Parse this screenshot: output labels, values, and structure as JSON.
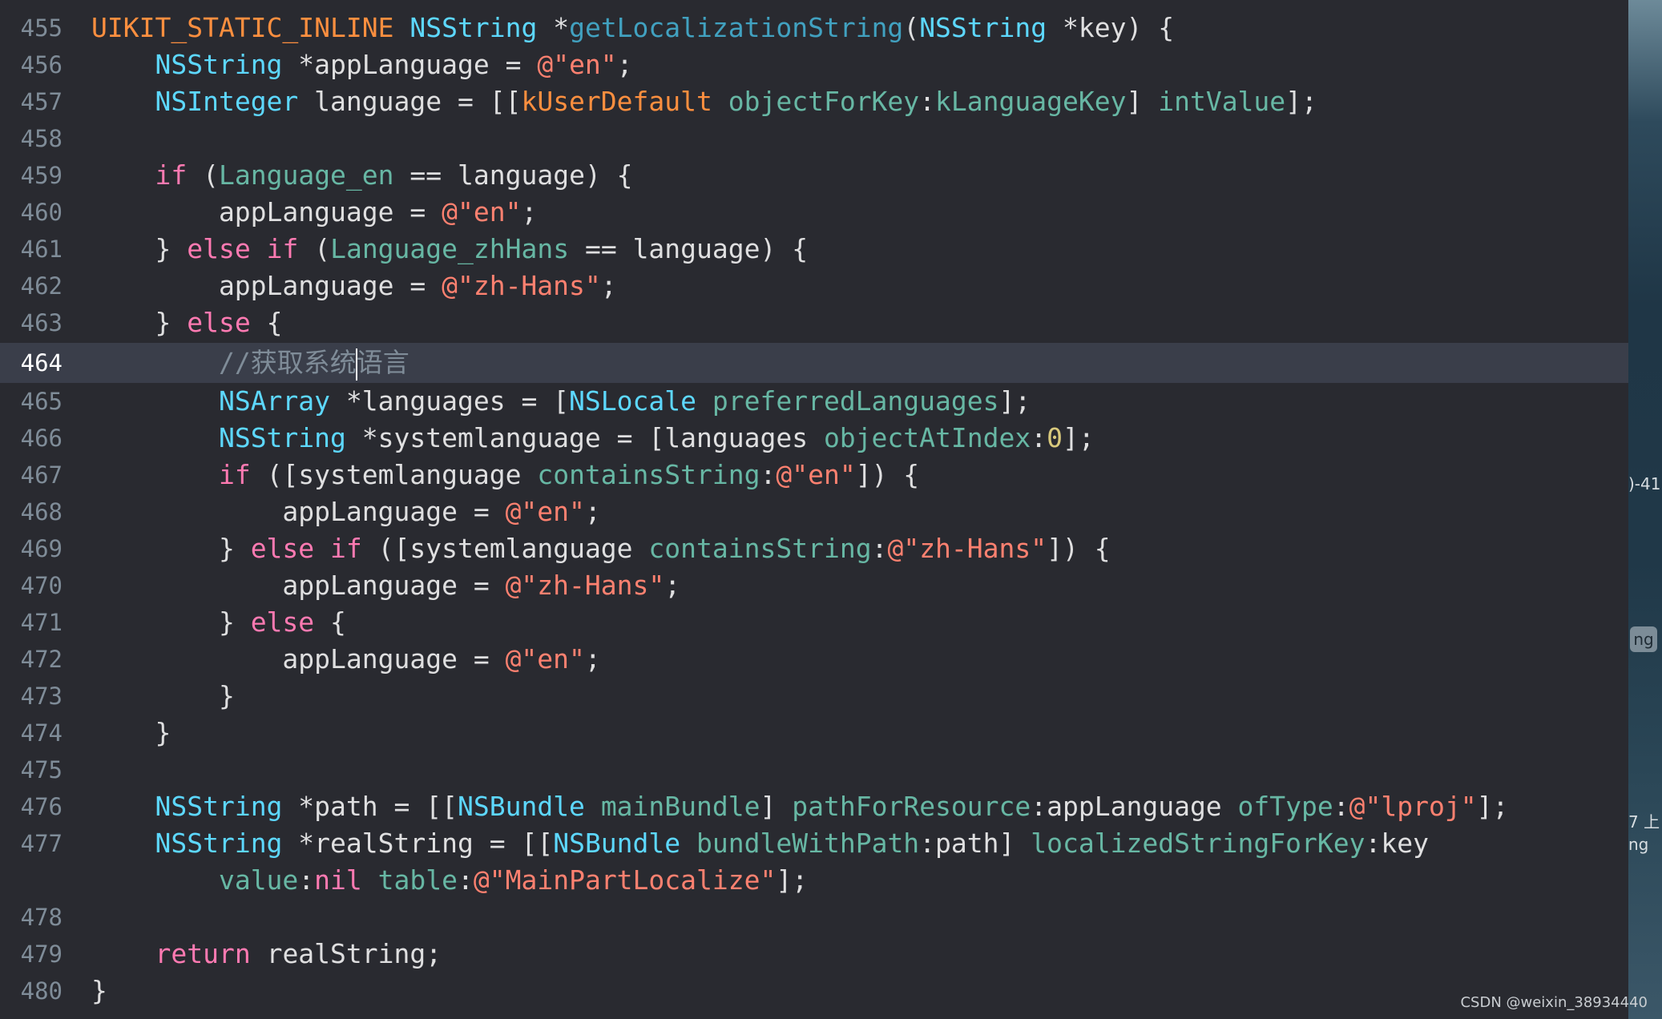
{
  "lines": [
    {
      "num": "455",
      "tokens": [
        {
          "t": "UIKIT_STATIC_INLINE",
          "c": "macro"
        },
        {
          "t": " ",
          "c": "plain"
        },
        {
          "t": "NSString",
          "c": "type"
        },
        {
          "t": " *",
          "c": "plain"
        },
        {
          "t": "getLocalizationString",
          "c": "decl"
        },
        {
          "t": "(",
          "c": "plain"
        },
        {
          "t": "NSString",
          "c": "type"
        },
        {
          "t": " *key) {",
          "c": "plain"
        }
      ]
    },
    {
      "num": "456",
      "tokens": [
        {
          "t": "    ",
          "c": "plain"
        },
        {
          "t": "NSString",
          "c": "type"
        },
        {
          "t": " *appLanguage = ",
          "c": "plain"
        },
        {
          "t": "@\"en\"",
          "c": "str"
        },
        {
          "t": ";",
          "c": "plain"
        }
      ]
    },
    {
      "num": "457",
      "tokens": [
        {
          "t": "    ",
          "c": "plain"
        },
        {
          "t": "NSInteger",
          "c": "type"
        },
        {
          "t": " language = [[",
          "c": "plain"
        },
        {
          "t": "kUserDefault",
          "c": "kuser"
        },
        {
          "t": " ",
          "c": "plain"
        },
        {
          "t": "objectForKey",
          "c": "fn"
        },
        {
          "t": ":",
          "c": "plain"
        },
        {
          "t": "kLanguageKey",
          "c": "fn"
        },
        {
          "t": "] ",
          "c": "plain"
        },
        {
          "t": "intValue",
          "c": "fn"
        },
        {
          "t": "];",
          "c": "plain"
        }
      ]
    },
    {
      "num": "458",
      "tokens": []
    },
    {
      "num": "459",
      "tokens": [
        {
          "t": "    ",
          "c": "plain"
        },
        {
          "t": "if",
          "c": "kw"
        },
        {
          "t": " (",
          "c": "plain"
        },
        {
          "t": "Language_en",
          "c": "fn"
        },
        {
          "t": " == language) {",
          "c": "plain"
        }
      ]
    },
    {
      "num": "460",
      "tokens": [
        {
          "t": "        appLanguage = ",
          "c": "plain"
        },
        {
          "t": "@\"en\"",
          "c": "str"
        },
        {
          "t": ";",
          "c": "plain"
        }
      ]
    },
    {
      "num": "461",
      "tokens": [
        {
          "t": "    } ",
          "c": "plain"
        },
        {
          "t": "else",
          "c": "kw"
        },
        {
          "t": " ",
          "c": "plain"
        },
        {
          "t": "if",
          "c": "kw"
        },
        {
          "t": " (",
          "c": "plain"
        },
        {
          "t": "Language_zhHans",
          "c": "fn"
        },
        {
          "t": " == language) {",
          "c": "plain"
        }
      ]
    },
    {
      "num": "462",
      "tokens": [
        {
          "t": "        appLanguage = ",
          "c": "plain"
        },
        {
          "t": "@\"zh-Hans\"",
          "c": "str"
        },
        {
          "t": ";",
          "c": "plain"
        }
      ]
    },
    {
      "num": "463",
      "tokens": [
        {
          "t": "    } ",
          "c": "plain"
        },
        {
          "t": "else",
          "c": "kw"
        },
        {
          "t": " {",
          "c": "plain"
        }
      ]
    },
    {
      "num": "464",
      "current": true,
      "tokens": [
        {
          "t": "        ",
          "c": "plain"
        },
        {
          "t": "//获取系统",
          "c": "comment"
        },
        {
          "t": "",
          "c": "cursor"
        },
        {
          "t": "语言",
          "c": "comment"
        }
      ]
    },
    {
      "num": "465",
      "tokens": [
        {
          "t": "        ",
          "c": "plain"
        },
        {
          "t": "NSArray",
          "c": "type"
        },
        {
          "t": " *languages = [",
          "c": "plain"
        },
        {
          "t": "NSLocale",
          "c": "type"
        },
        {
          "t": " ",
          "c": "plain"
        },
        {
          "t": "preferredLanguages",
          "c": "fn"
        },
        {
          "t": "];",
          "c": "plain"
        }
      ]
    },
    {
      "num": "466",
      "tokens": [
        {
          "t": "        ",
          "c": "plain"
        },
        {
          "t": "NSString",
          "c": "type"
        },
        {
          "t": " *systemlanguage = [languages ",
          "c": "plain"
        },
        {
          "t": "objectAtIndex",
          "c": "fn"
        },
        {
          "t": ":",
          "c": "plain"
        },
        {
          "t": "0",
          "c": "num"
        },
        {
          "t": "];",
          "c": "plain"
        }
      ]
    },
    {
      "num": "467",
      "tokens": [
        {
          "t": "        ",
          "c": "plain"
        },
        {
          "t": "if",
          "c": "kw"
        },
        {
          "t": " ([systemlanguage ",
          "c": "plain"
        },
        {
          "t": "containsString",
          "c": "fn"
        },
        {
          "t": ":",
          "c": "plain"
        },
        {
          "t": "@\"en\"",
          "c": "str"
        },
        {
          "t": "]) {",
          "c": "plain"
        }
      ]
    },
    {
      "num": "468",
      "tokens": [
        {
          "t": "            appLanguage = ",
          "c": "plain"
        },
        {
          "t": "@\"en\"",
          "c": "str"
        },
        {
          "t": ";",
          "c": "plain"
        }
      ]
    },
    {
      "num": "469",
      "tokens": [
        {
          "t": "        } ",
          "c": "plain"
        },
        {
          "t": "else",
          "c": "kw"
        },
        {
          "t": " ",
          "c": "plain"
        },
        {
          "t": "if",
          "c": "kw"
        },
        {
          "t": " ([systemlanguage ",
          "c": "plain"
        },
        {
          "t": "containsString",
          "c": "fn"
        },
        {
          "t": ":",
          "c": "plain"
        },
        {
          "t": "@\"zh-Hans\"",
          "c": "str"
        },
        {
          "t": "]) {",
          "c": "plain"
        }
      ]
    },
    {
      "num": "470",
      "tokens": [
        {
          "t": "            appLanguage = ",
          "c": "plain"
        },
        {
          "t": "@\"zh-Hans\"",
          "c": "str"
        },
        {
          "t": ";",
          "c": "plain"
        }
      ]
    },
    {
      "num": "471",
      "tokens": [
        {
          "t": "        } ",
          "c": "plain"
        },
        {
          "t": "else",
          "c": "kw"
        },
        {
          "t": " {",
          "c": "plain"
        }
      ]
    },
    {
      "num": "472",
      "tokens": [
        {
          "t": "            appLanguage = ",
          "c": "plain"
        },
        {
          "t": "@\"en\"",
          "c": "str"
        },
        {
          "t": ";",
          "c": "plain"
        }
      ]
    },
    {
      "num": "473",
      "tokens": [
        {
          "t": "        }",
          "c": "plain"
        }
      ]
    },
    {
      "num": "474",
      "tokens": [
        {
          "t": "    }",
          "c": "plain"
        }
      ]
    },
    {
      "num": "475",
      "tokens": []
    },
    {
      "num": "476",
      "tokens": [
        {
          "t": "    ",
          "c": "plain"
        },
        {
          "t": "NSString",
          "c": "type"
        },
        {
          "t": " *path = [[",
          "c": "plain"
        },
        {
          "t": "NSBundle",
          "c": "type"
        },
        {
          "t": " ",
          "c": "plain"
        },
        {
          "t": "mainBundle",
          "c": "fn"
        },
        {
          "t": "] ",
          "c": "plain"
        },
        {
          "t": "pathForResource",
          "c": "fn"
        },
        {
          "t": ":appLanguage ",
          "c": "plain"
        },
        {
          "t": "ofType",
          "c": "fn"
        },
        {
          "t": ":",
          "c": "plain"
        },
        {
          "t": "@\"lproj\"",
          "c": "str"
        },
        {
          "t": "];",
          "c": "plain"
        }
      ]
    },
    {
      "num": "477",
      "tokens": [
        {
          "t": "    ",
          "c": "plain"
        },
        {
          "t": "NSString",
          "c": "type"
        },
        {
          "t": " *realString = [[",
          "c": "plain"
        },
        {
          "t": "NSBundle",
          "c": "type"
        },
        {
          "t": " ",
          "c": "plain"
        },
        {
          "t": "bundleWithPath",
          "c": "fn"
        },
        {
          "t": ":path] ",
          "c": "plain"
        },
        {
          "t": "localizedStringForKey",
          "c": "fn"
        },
        {
          "t": ":key",
          "c": "plain"
        }
      ]
    },
    {
      "num": "",
      "tokens": [
        {
          "t": "        ",
          "c": "plain"
        },
        {
          "t": "value",
          "c": "fn"
        },
        {
          "t": ":",
          "c": "plain"
        },
        {
          "t": "nil",
          "c": "kw"
        },
        {
          "t": " ",
          "c": "plain"
        },
        {
          "t": "table",
          "c": "fn"
        },
        {
          "t": ":",
          "c": "plain"
        },
        {
          "t": "@\"MainPartLocalize\"",
          "c": "str"
        },
        {
          "t": "];",
          "c": "plain"
        }
      ]
    },
    {
      "num": "478",
      "tokens": []
    },
    {
      "num": "479",
      "tokens": [
        {
          "t": "    ",
          "c": "plain"
        },
        {
          "t": "return",
          "c": "kw"
        },
        {
          "t": " realString;",
          "c": "plain"
        }
      ]
    },
    {
      "num": "480",
      "tokens": [
        {
          "t": "}",
          "c": "plain"
        }
      ]
    }
  ],
  "right_strip": {
    "label_1": ")-41",
    "badge": "ng",
    "label_2": "7 上",
    "label_3": "ng"
  },
  "watermark": "CSDN @weixin_38934440",
  "colors": {
    "background": "#292A30",
    "current_line": "#3A3E4A",
    "keyword": "#FF7AB2",
    "string": "#FF8170",
    "type": "#5DD8FF",
    "method": "#67B7A4",
    "macro": "#FD8F3F",
    "comment": "#7F8C98",
    "number": "#D9C97C"
  }
}
